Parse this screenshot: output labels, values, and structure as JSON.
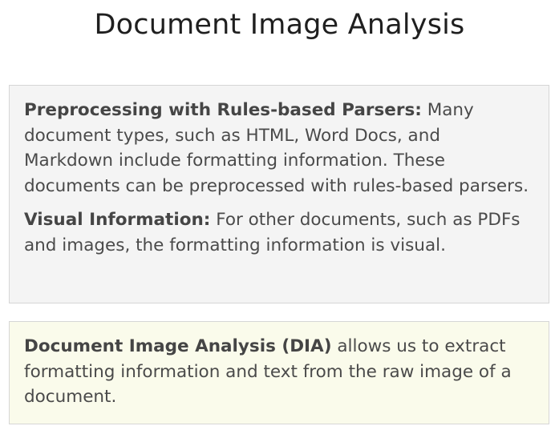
{
  "title": "Document Image Analysis",
  "info_box": {
    "paragraphs": [
      {
        "heading": "Preprocessing with Rules-based Parsers:",
        "text": "Many document types, such as HTML, Word Docs, and Markdown include formatting information. These documents can be preprocessed with rules-based parsers."
      },
      {
        "heading": "Visual Information:",
        "text": "For other documents, such as PDFs and images, the formatting information is visual."
      }
    ]
  },
  "highlight_box": {
    "heading": "Document Image Analysis (DIA)",
    "text": "allows us to extract formatting information and text from the raw image of a document."
  }
}
